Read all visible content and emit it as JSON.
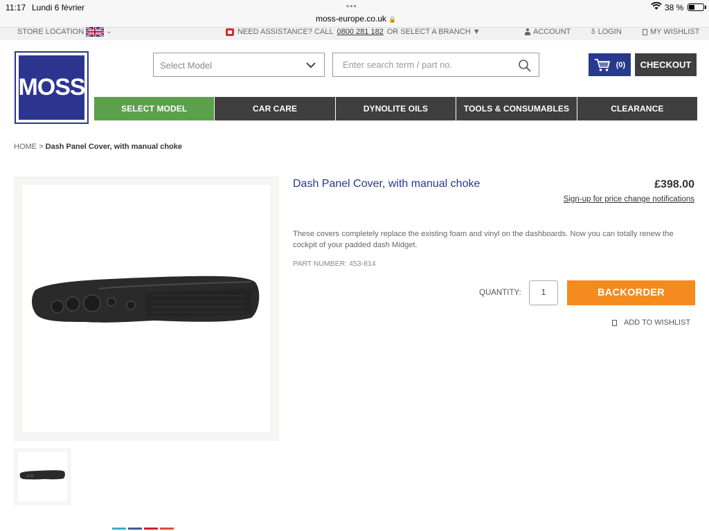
{
  "status_bar": {
    "time": "11:17",
    "date": "Lundi 6 février",
    "url": "moss-europe.co.uk",
    "battery_percent": "38 %",
    "battery_level": 0.38
  },
  "utility_bar": {
    "store_location": "STORE LOCATION",
    "assistance_prefix": "NEED ASSISTANCE? CALL",
    "phone": "0800 281 182",
    "assistance_suffix": "OR SELECT A BRANCH",
    "account": "ACCOUNT",
    "login": "LOGIN",
    "wishlist": "MY WISHLIST"
  },
  "header": {
    "logo_text": "MOSS",
    "model_select": {
      "value": "Select Model"
    },
    "search": {
      "placeholder": "Enter search term / part no."
    },
    "cart_count": "(0)",
    "checkout_label": "CHECKOUT",
    "brand_color": "#2b3590"
  },
  "nav": {
    "items": [
      {
        "label": "SELECT MODEL",
        "active": true
      },
      {
        "label": "CAR CARE",
        "active": false
      },
      {
        "label": "DYNOLITE OILS",
        "active": false
      },
      {
        "label": "TOOLS & CONSUMABLES",
        "active": false
      },
      {
        "label": "CLEARANCE",
        "active": false
      }
    ],
    "active_color": "#5aa14a",
    "inactive_color": "#3f3f3f"
  },
  "breadcrumb": {
    "home": "HOME",
    "separator": ">",
    "current": "Dash Panel Cover, with manual choke"
  },
  "product": {
    "title": "Dash Panel Cover, with manual choke",
    "price": "£398.00",
    "price_notify": "Sign-up for price change notifications",
    "description": "These covers completely replace the existing foam and vinyl on the dashboards. Now you can totally renew the cockpit of your padded dash Midget.",
    "part_number": "PART NUMBER: 453-814",
    "quantity_label": "QUANTITY:",
    "quantity": "1",
    "backorder_label": "BACKORDER",
    "backorder_color": "#f58a1f",
    "wishlist_label": "ADD TO WISHLIST"
  },
  "share_colors": [
    "#3fa9d6",
    "#3b5998",
    "#cb2027",
    "#dd4b39"
  ]
}
